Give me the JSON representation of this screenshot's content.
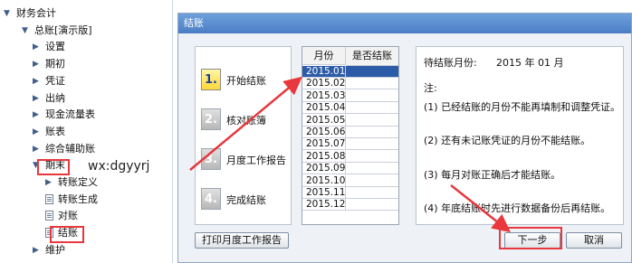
{
  "nav": {
    "items": [
      {
        "label": "财务会计",
        "level": 0,
        "marker": "open"
      },
      {
        "label": "总账[演示版]",
        "level": 1,
        "marker": "open"
      },
      {
        "label": "设置",
        "level": 2,
        "marker": "closed"
      },
      {
        "label": "期初",
        "level": 2,
        "marker": "closed"
      },
      {
        "label": "凭证",
        "level": 2,
        "marker": "closed"
      },
      {
        "label": "出纳",
        "level": 2,
        "marker": "closed"
      },
      {
        "label": "现金流量表",
        "level": 2,
        "marker": "closed"
      },
      {
        "label": "账表",
        "level": 2,
        "marker": "closed"
      },
      {
        "label": "综合辅助账",
        "level": 2,
        "marker": "closed"
      },
      {
        "label": "期末",
        "level": 2,
        "marker": "open"
      },
      {
        "label": "转账定义",
        "level": 3,
        "marker": "closed"
      },
      {
        "label": "转账生成",
        "level": 3,
        "marker": "doc"
      },
      {
        "label": "对账",
        "level": 3,
        "marker": "doc"
      },
      {
        "label": "结账",
        "level": 3,
        "marker": "doc"
      },
      {
        "label": "维护",
        "level": 2,
        "marker": "closed"
      }
    ]
  },
  "watermark": "wx:dgyyrj",
  "dialog": {
    "title": "结账",
    "steps": [
      {
        "num": "1.",
        "label": "开始结账",
        "active": true
      },
      {
        "num": "2.",
        "label": "核对账簿",
        "active": false
      },
      {
        "num": "3.",
        "label": "月度工作报告",
        "active": false
      },
      {
        "num": "4.",
        "label": "完成结账",
        "active": false
      }
    ],
    "table": {
      "headers": [
        "月份",
        "是否结账"
      ],
      "rows": [
        {
          "month": "2015.01",
          "closed": "",
          "selected": true
        },
        {
          "month": "2015.02",
          "closed": ""
        },
        {
          "month": "2015.03",
          "closed": ""
        },
        {
          "month": "2015.04",
          "closed": ""
        },
        {
          "month": "2015.05",
          "closed": ""
        },
        {
          "month": "2015.06",
          "closed": ""
        },
        {
          "month": "2015.07",
          "closed": ""
        },
        {
          "month": "2015.08",
          "closed": ""
        },
        {
          "month": "2015.09",
          "closed": ""
        },
        {
          "month": "2015.10",
          "closed": ""
        },
        {
          "month": "2015.11",
          "closed": ""
        },
        {
          "month": "2015.12",
          "closed": ""
        }
      ]
    },
    "info": {
      "month_label": "待结账月份:",
      "month_value": "2015 年 01 月",
      "note_title": "注:",
      "notes": [
        "(1) 已经结账的月份不能再填制和调整凭证。",
        "(2) 还有未记账凭证的月份不能结账。",
        "(3) 每月对账正确后才能结账。",
        "(4) 年底结账时先进行数据备份后再结账。"
      ]
    },
    "buttons": {
      "print_report": "打印月度工作报告",
      "next": "下一步",
      "cancel": "取消"
    }
  },
  "colors": {
    "annotation_red": "#e8383d",
    "selection_blue": "#2c5ca8",
    "title_blue": "#4a7ec4"
  }
}
